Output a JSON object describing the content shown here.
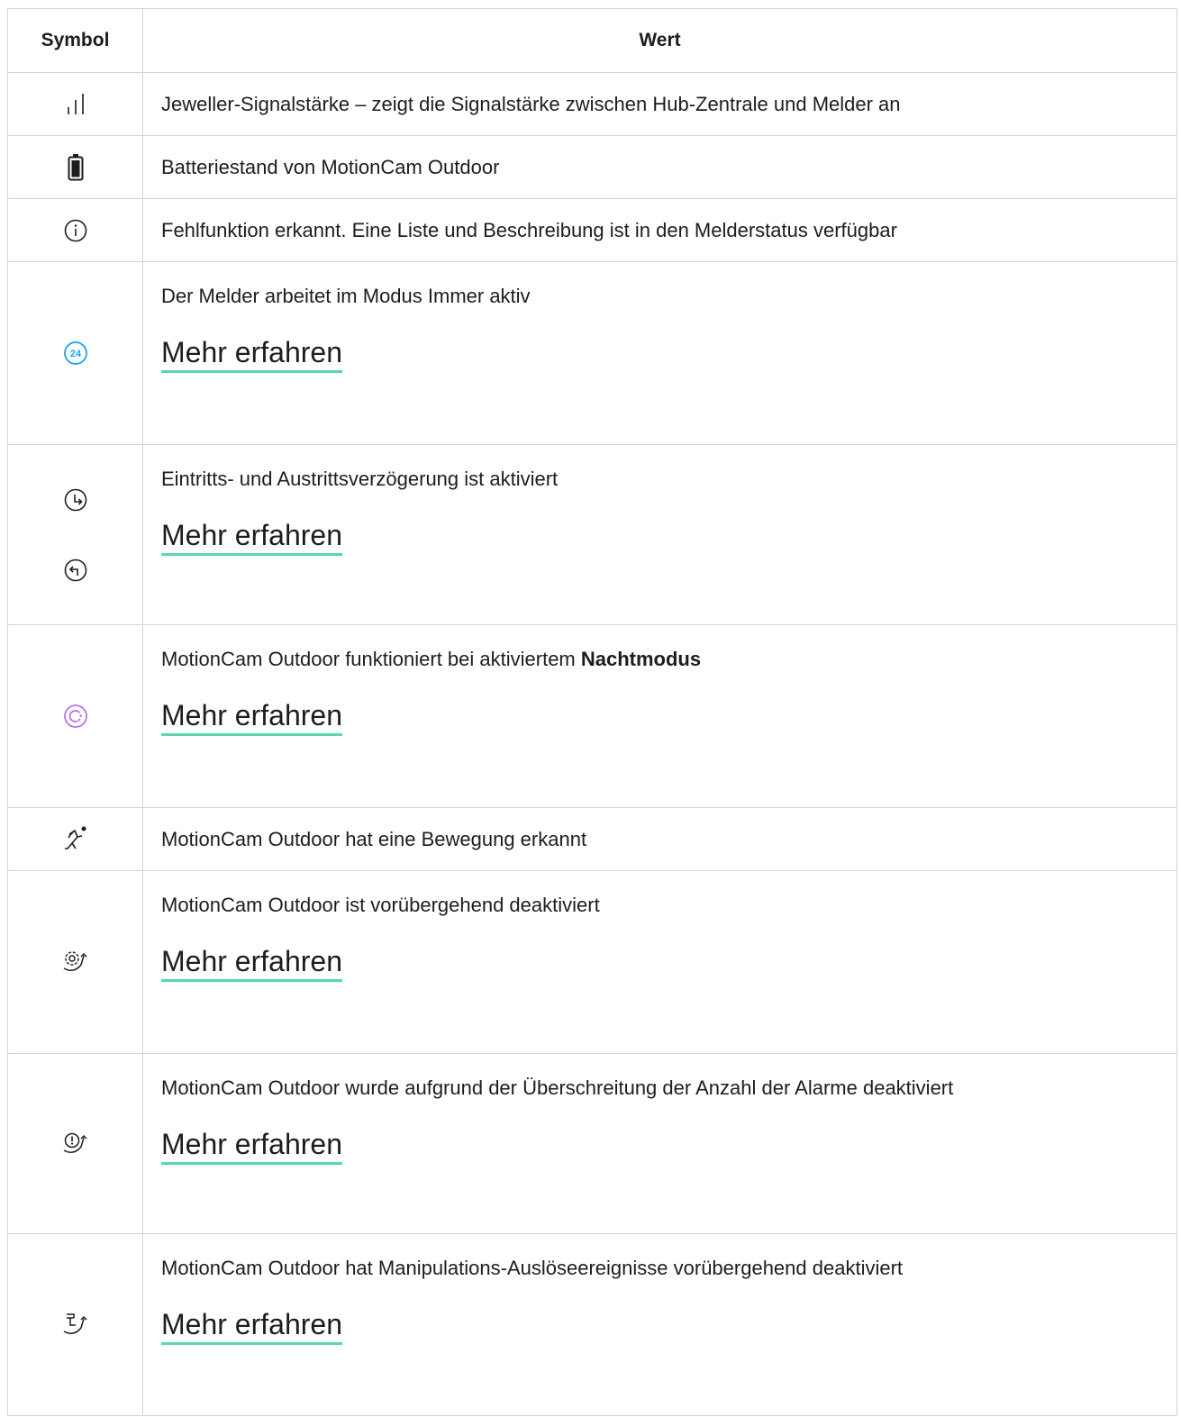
{
  "table": {
    "header": {
      "symbol": "Symbol",
      "value": "Wert"
    },
    "rows": [
      {
        "icon": "signal-strength-icon",
        "text": "Jeweller-Signalstärke – zeigt die Signalstärke zwischen Hub-Zentrale und Melder an"
      },
      {
        "icon": "battery-icon",
        "text": "Batteriestand von MotionCam Outdoor"
      },
      {
        "icon": "info-circle-icon",
        "text": "Fehlfunktion erkannt. Eine Liste und Beschreibung ist in den Melderstatus verfügbar"
      },
      {
        "icon": "always-active-24-icon",
        "icon_color": "#1ba1f2",
        "text": "Der Melder arbeitet im Modus Immer aktiv",
        "link": "Mehr erfahren"
      },
      {
        "icon": "entry-exit-delay-icons",
        "text": "Eintritts- und Austrittsverzögerung ist aktiviert",
        "link": "Mehr erfahren"
      },
      {
        "icon": "night-mode-icon",
        "icon_color": "#b574f2",
        "text_before": "MotionCam Outdoor funktioniert bei aktiviertem ",
        "text_bold": "Nachtmodus",
        "link": "Mehr erfahren"
      },
      {
        "icon": "motion-detected-icon",
        "text": "MotionCam Outdoor hat eine Bewegung erkannt"
      },
      {
        "icon": "temporarily-deactivated-icon",
        "text": "MotionCam Outdoor ist vorübergehend deaktiviert",
        "link": "Mehr erfahren"
      },
      {
        "icon": "alarm-limit-deactivated-icon",
        "text": "MotionCam Outdoor wurde aufgrund der Überschreitung der Anzahl der Alarme deaktiviert",
        "link": "Mehr erfahren"
      },
      {
        "icon": "tamper-deactivated-icon",
        "text": "MotionCam Outdoor hat Manipulations-Auslöseereignisse vorübergehend deaktiviert",
        "link": "Mehr erfahren"
      }
    ]
  },
  "colors": {
    "border": "#d4d4d4",
    "link_underline": "#5ad8a6",
    "text": "#1d1d1d"
  }
}
